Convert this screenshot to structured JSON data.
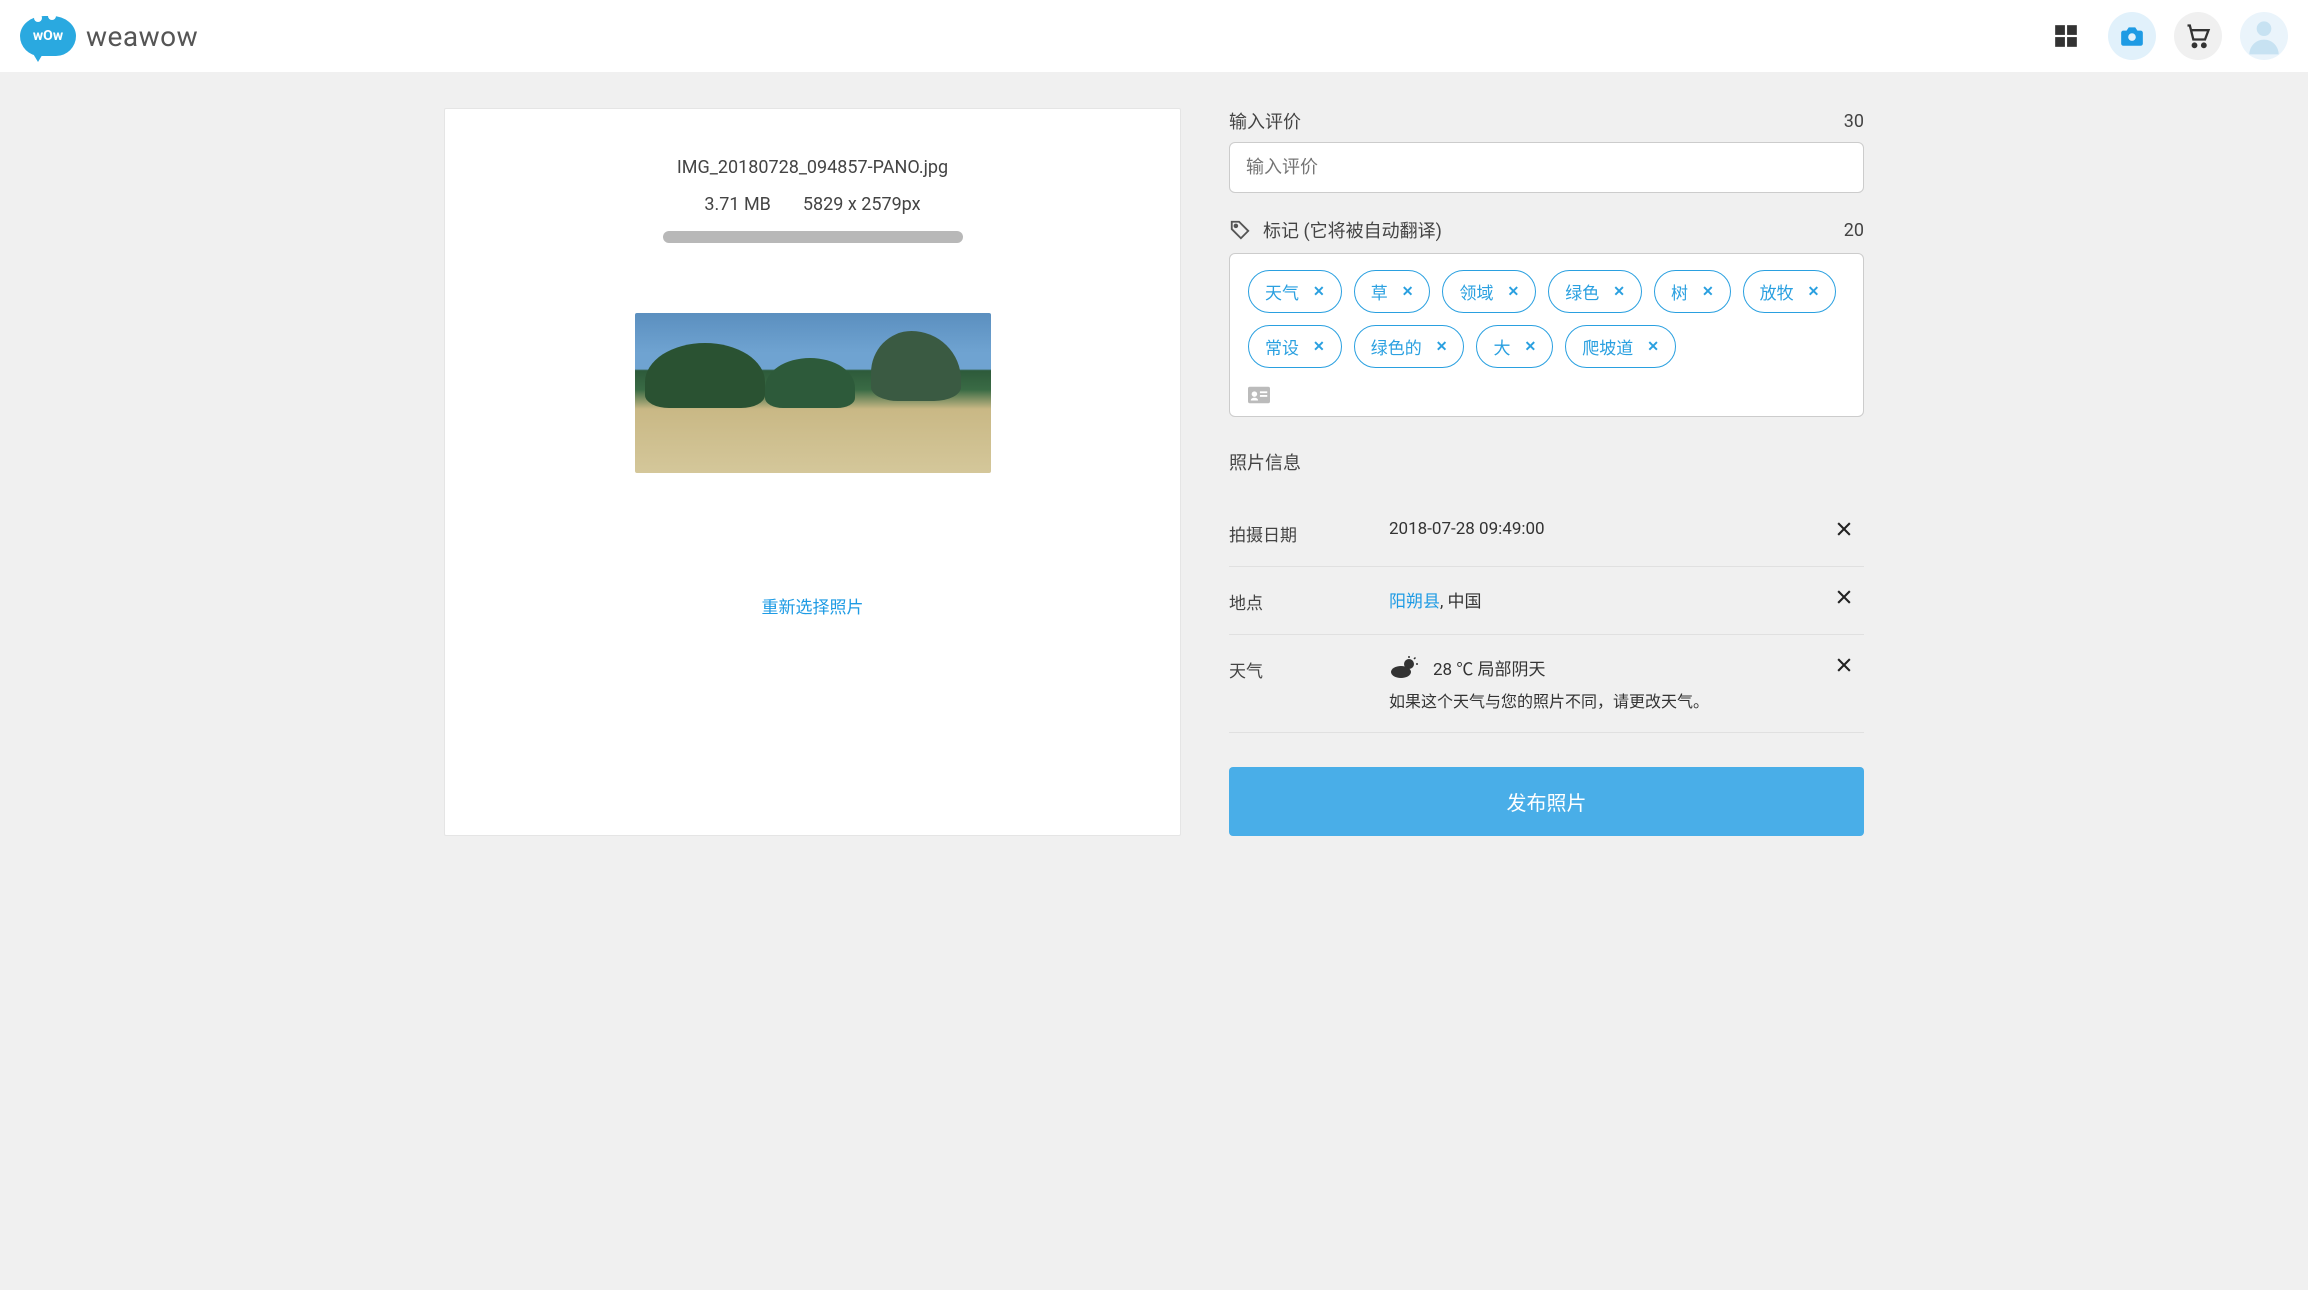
{
  "brand": {
    "name": "weawow",
    "cloud_text": "wOw"
  },
  "upload": {
    "filename": "IMG_20180728_094857-PANO.jpg",
    "filesize": "3.71 MB",
    "dimensions": "5829 x 2579px",
    "reselect_label": "重新选择照片"
  },
  "review": {
    "label": "输入评价",
    "placeholder": "输入评价",
    "limit": "30"
  },
  "tags": {
    "label": "标记",
    "hint": "(它将被自动翻译)",
    "limit": "20",
    "items": [
      "天气",
      "草",
      "领域",
      "绿色",
      "树",
      "放牧",
      "常设",
      "绿色的",
      "大",
      "爬坡道"
    ]
  },
  "info": {
    "section_label": "照片信息",
    "date_label": "拍摄日期",
    "date_value": "2018-07-28 09:49:00",
    "location_label": "地点",
    "location_link": "阳朔县",
    "location_suffix": ", 中国",
    "weather_label": "天气",
    "weather_temp": "28",
    "weather_unit": "℃",
    "weather_desc": "局部阴天",
    "weather_note": "如果这个天气与您的照片不同，请更改天气。"
  },
  "publish_label": "发布照片"
}
